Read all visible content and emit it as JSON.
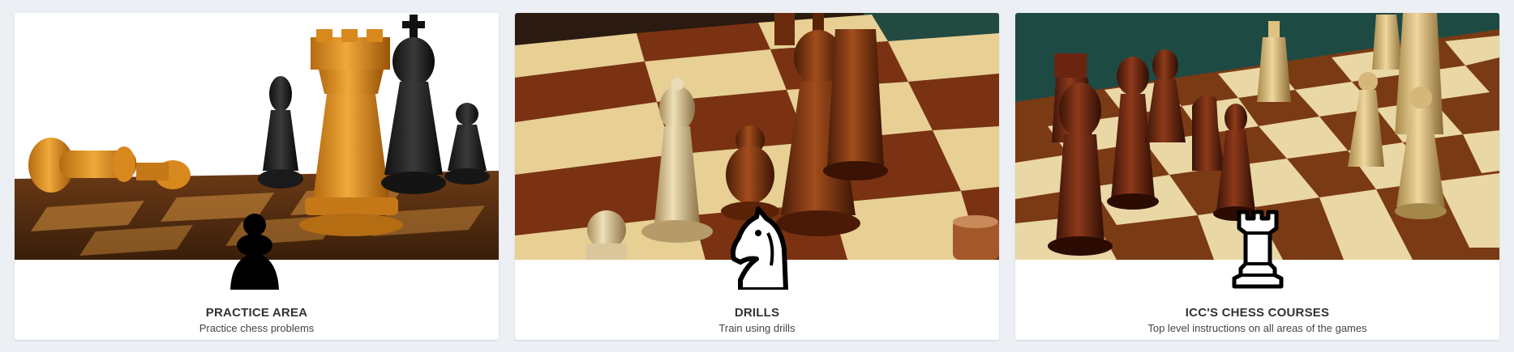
{
  "cards": [
    {
      "title": "PRACTICE AREA",
      "subtitle": "Practice chess problems",
      "icon": "pawn-icon"
    },
    {
      "title": "DRILLS",
      "subtitle": "Train using drills",
      "icon": "knight-icon"
    },
    {
      "title": "ICC'S CHESS COURSES",
      "subtitle": "Top level instructions on all areas of the games",
      "icon": "rook-icon"
    }
  ],
  "colors": {
    "page_background": "#eceff4",
    "card_background": "#ffffff",
    "title_text": "#333333",
    "subtitle_text": "#444444"
  }
}
